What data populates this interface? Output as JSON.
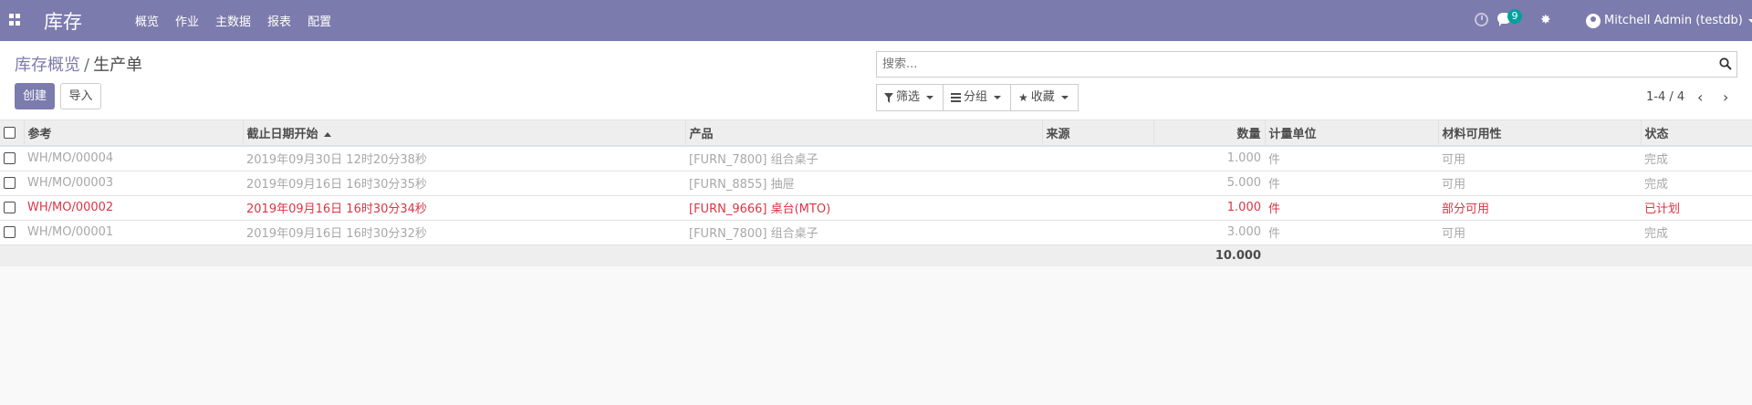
{
  "app": {
    "title": "库存",
    "menu": [
      "概览",
      "作业",
      "主数据",
      "报表",
      "配置"
    ],
    "chat_count": "9",
    "user": "Mitchell Admin (testdb)"
  },
  "breadcrumb": {
    "parent": "库存概览",
    "separator": "/",
    "current": "生产单"
  },
  "buttons": {
    "create": "创建",
    "import": "导入"
  },
  "search": {
    "placeholder": "搜索..."
  },
  "filters": {
    "filter": "筛选",
    "group": "分组",
    "favorites": "收藏"
  },
  "pager": {
    "value": "1-4 / 4"
  },
  "table": {
    "headers": {
      "reference": "参考",
      "deadline": "截止日期开始",
      "product": "产品",
      "source": "来源",
      "quantity": "数量",
      "uom": "计量单位",
      "availability": "材料可用性",
      "state": "状态"
    },
    "rows": [
      {
        "ref": "WH/MO/00004",
        "date": "2019年09月30日 12时20分38秒",
        "product": "[FURN_7800] 组合桌子",
        "source": "",
        "qty": "1.000",
        "uom": "件",
        "avail": "可用",
        "state": "完成"
      },
      {
        "ref": "WH/MO/00003",
        "date": "2019年09月16日 16时30分35秒",
        "product": "[FURN_8855] 抽屉",
        "source": "",
        "qty": "5.000",
        "uom": "件",
        "avail": "可用",
        "state": "完成"
      },
      {
        "ref": "WH/MO/00002",
        "date": "2019年09月16日 16时30分34秒",
        "product": "[FURN_9666] 桌台(MTO)",
        "source": "",
        "qty": "1.000",
        "uom": "件",
        "avail": "部分可用",
        "state": "已计划"
      },
      {
        "ref": "WH/MO/00001",
        "date": "2019年09月16日 16时30分32秒",
        "product": "[FURN_7800] 组合桌子",
        "source": "",
        "qty": "3.000",
        "uom": "件",
        "avail": "可用",
        "state": "完成"
      }
    ],
    "total_qty": "10.000"
  },
  "colors": {
    "brand": "#7c7bad",
    "muted": "#a8a8a8",
    "danger": "#dc3545",
    "badge": "#00a09d"
  },
  "icons": [
    "apps-grid-icon",
    "clock-icon",
    "chat-icon",
    "bug-icon",
    "user-avatar-icon",
    "search-icon",
    "filter-icon",
    "group-icon",
    "star-icon",
    "chevron-left-icon",
    "chevron-right-icon",
    "sort-asc-icon"
  ]
}
